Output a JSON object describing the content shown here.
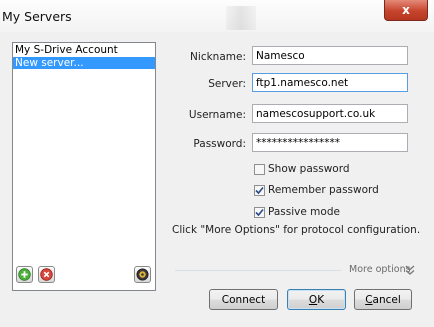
{
  "window": {
    "title": "My Servers",
    "close_label": "x"
  },
  "server_list": {
    "items": [
      {
        "label": "My S-Drive Account",
        "selected": false
      },
      {
        "label": "New server...",
        "selected": true
      }
    ]
  },
  "form": {
    "nickname_label": "Nickname:",
    "nickname_value": "Namesco",
    "server_label": "Server:",
    "server_value": "ftp1.namesco.net",
    "username_label": "Username:",
    "username_value": "namescosupport.co.uk",
    "password_label": "Password:",
    "password_value": "****************",
    "show_password_label": "Show password",
    "show_password_checked": false,
    "remember_password_label": "Remember password",
    "remember_password_checked": true,
    "passive_mode_label": "Passive mode",
    "passive_mode_checked": true,
    "hint": "Click \"More Options\" for protocol configuration.",
    "more_options_label": "More options"
  },
  "buttons": {
    "connect_label": "Connect",
    "ok_accel": "O",
    "ok_rest": "K",
    "cancel_accel": "C",
    "cancel_rest": "ancel"
  },
  "icons": {
    "add": "add-server-icon",
    "remove": "remove-server-icon",
    "settings": "server-settings-icon",
    "more_options": "double-chevron-down-icon"
  },
  "colors": {
    "selection": "#3399ff",
    "close_button": "#c6442d",
    "dialog_background": "#f0f0f0"
  }
}
